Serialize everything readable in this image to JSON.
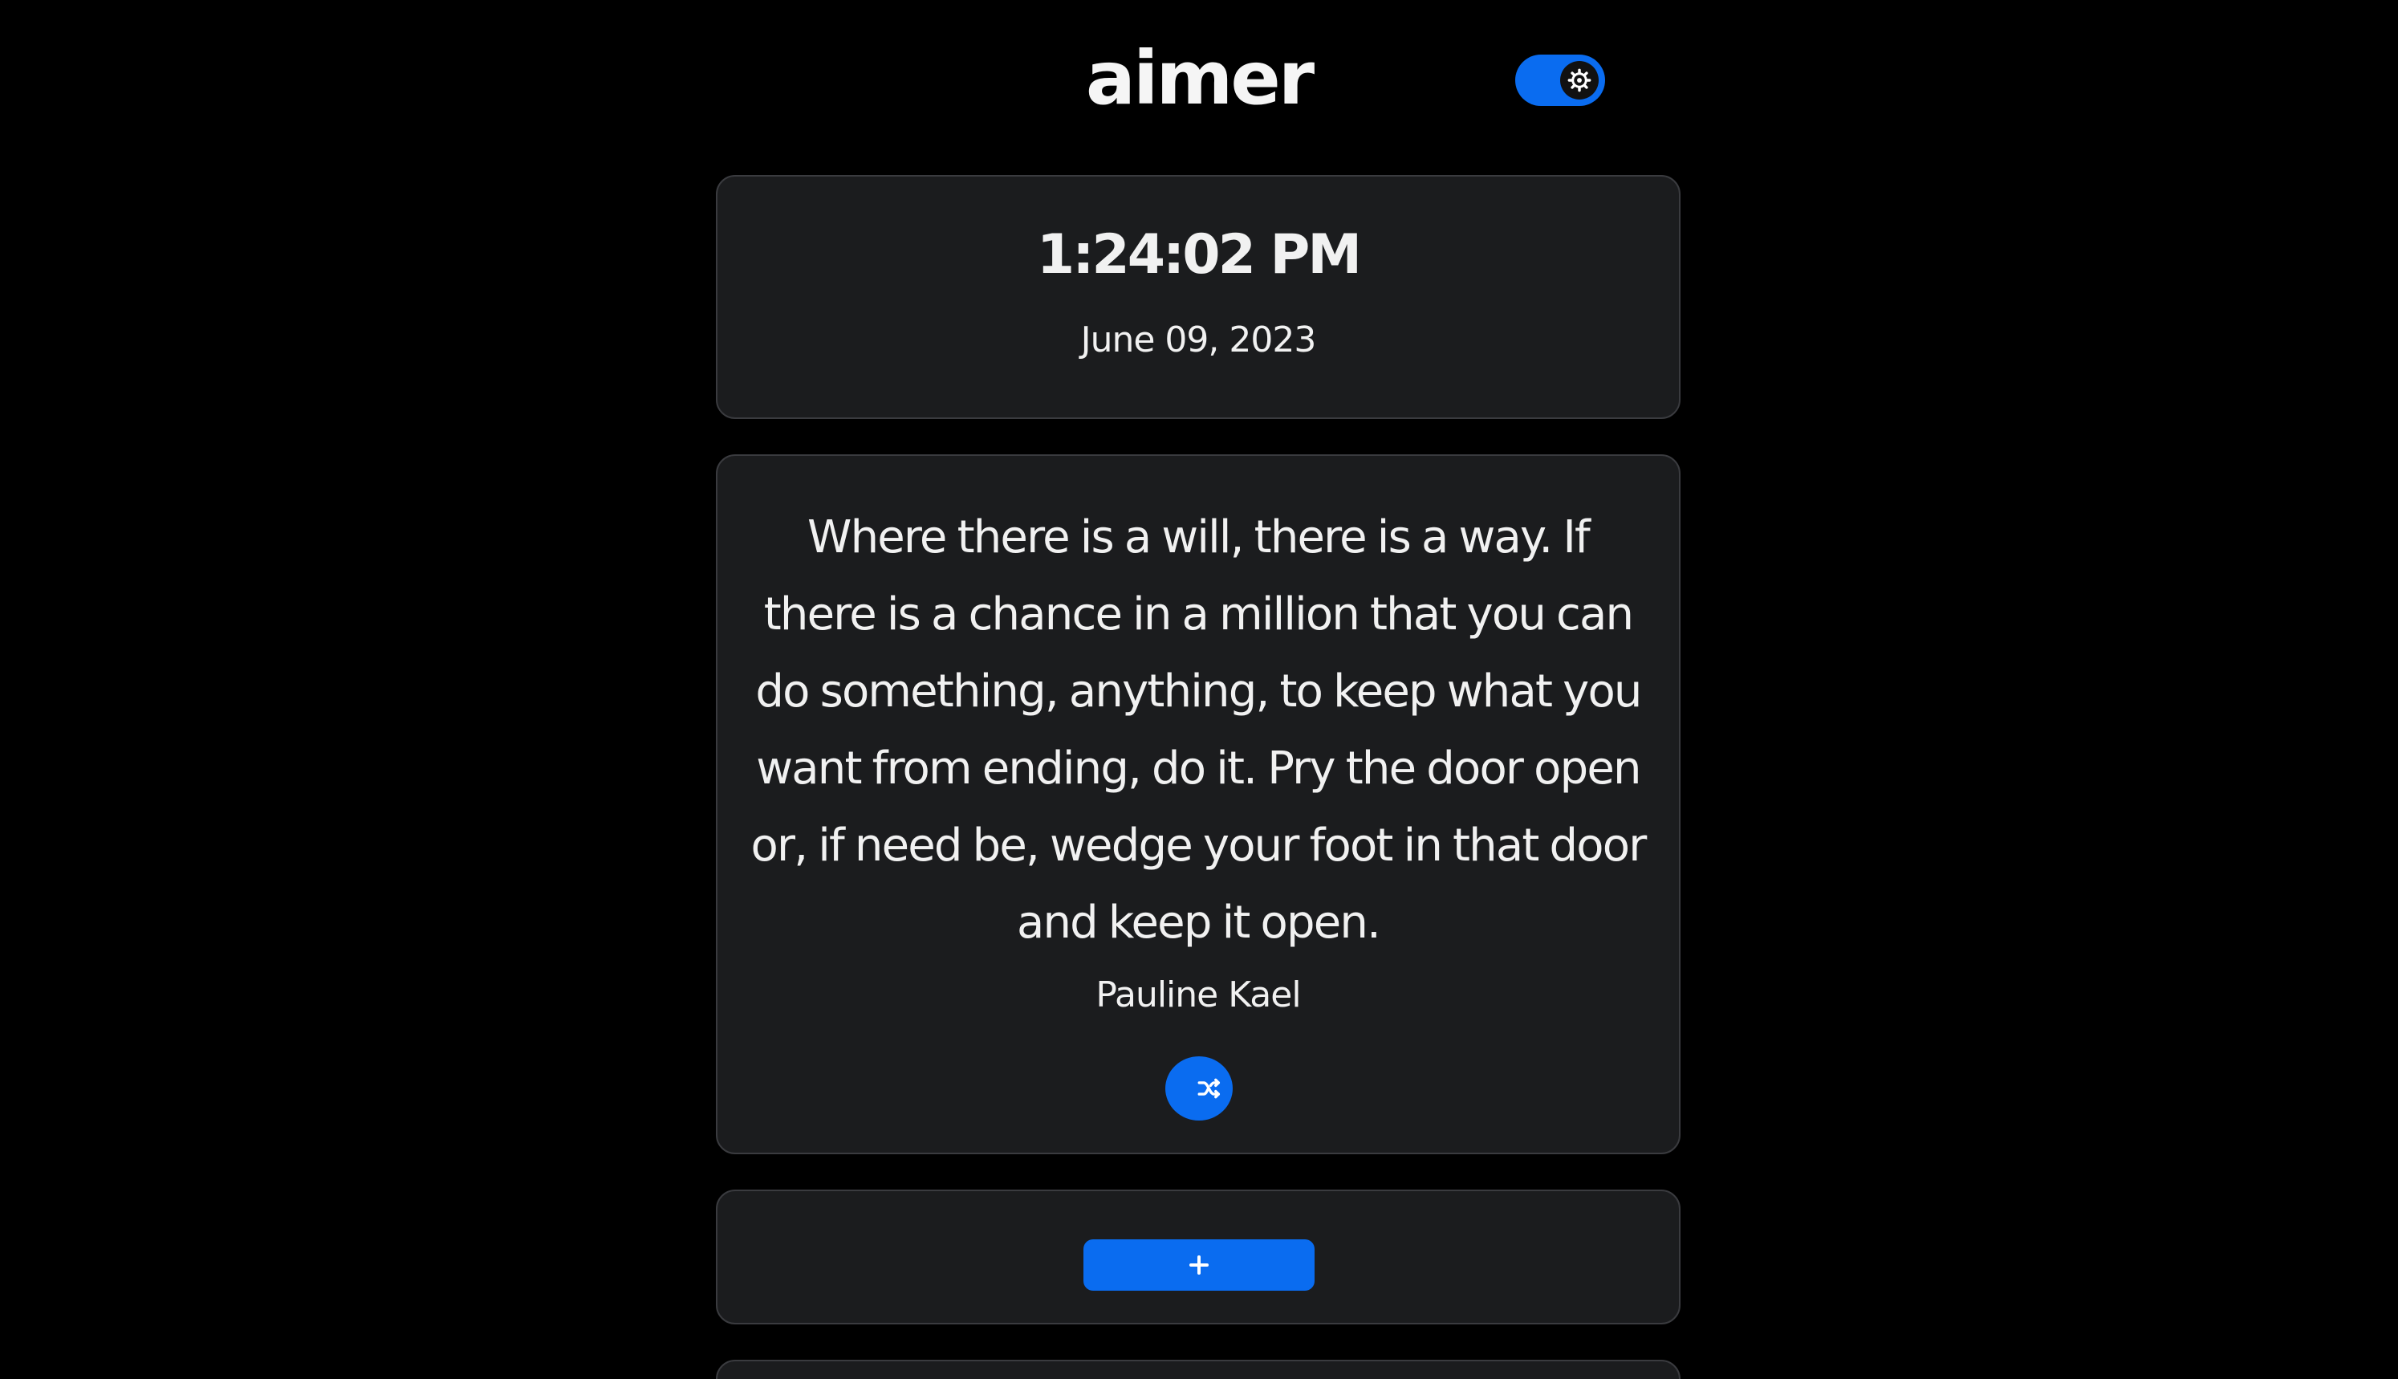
{
  "app": {
    "title": "aimer"
  },
  "colors": {
    "accent": "#0a6cf0",
    "card_background": "#1b1c1e",
    "card_border": "#3a3b3f",
    "page_background": "#000000",
    "text": "#f1f1f1"
  },
  "header": {
    "theme_toggle": {
      "state": "on",
      "icon": "gear-icon"
    }
  },
  "clock": {
    "time": "1:24:02 PM",
    "date": "June 09, 2023"
  },
  "quote": {
    "text": "Where there is a will, there is a way. If there is a chance in a million that you can do something, anything, to keep what you want from ending, do it. Pry the door open or, if need be, wedge your foot in that door and keep it open.",
    "author": "Pauline Kael",
    "shuffle_icon": "shuffle-icon"
  },
  "add_section": {
    "add_icon": "plus-icon"
  }
}
